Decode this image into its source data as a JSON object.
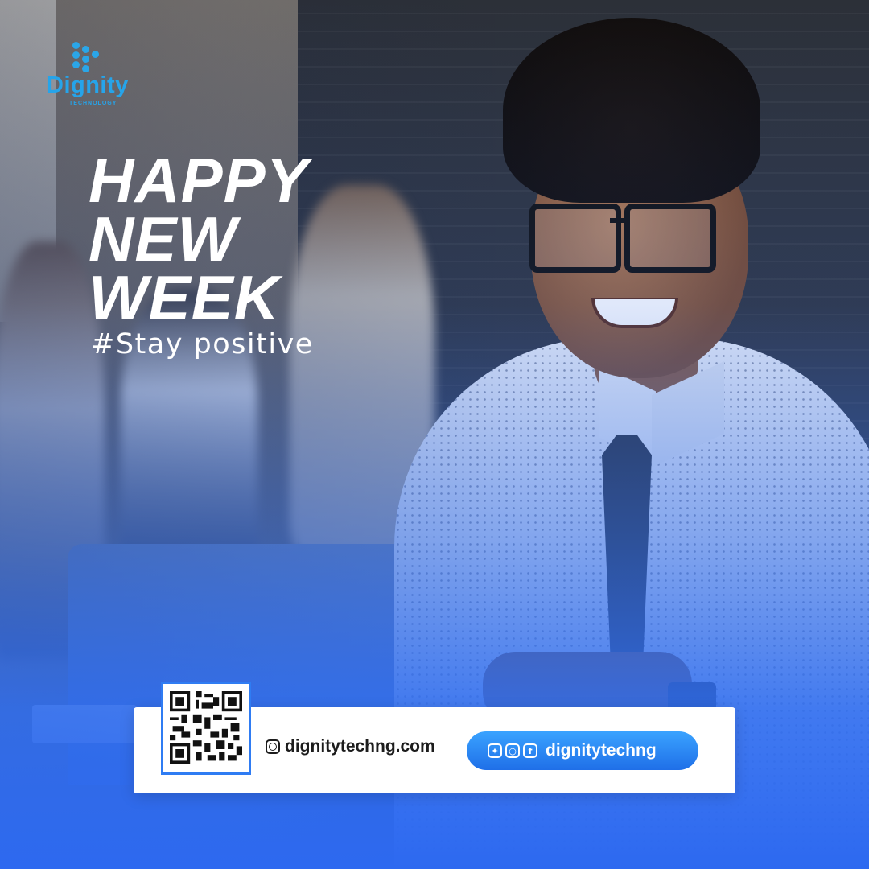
{
  "brand": {
    "name": "Dignity",
    "subtitle": "TECHNOLOGY",
    "accent_color": "#26a4ea",
    "primary_blue": "#2f6ff0"
  },
  "headline": {
    "lines": [
      "HAPPY",
      "NEW",
      "WEEK"
    ]
  },
  "tagline": "#Stay positive",
  "footer": {
    "website": "dignitytechng.com",
    "website_icon": "globe-icon",
    "social_icons": [
      "twitter-icon",
      "instagram-icon",
      "facebook-icon"
    ],
    "social_handle": "dignitytechng",
    "qr_icon": "qr-code"
  }
}
